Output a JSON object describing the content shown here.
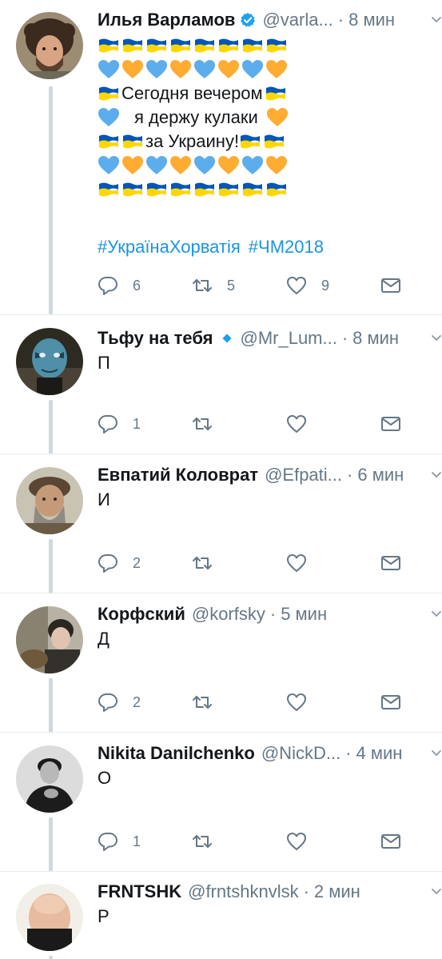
{
  "tweets": [
    {
      "name": "Илья Варламов",
      "verified": true,
      "handle": "@varla...",
      "separator": "·",
      "time": "8 мин",
      "text_lines": [
        "Сегодня вечером",
        "я держу кулаки",
        "за Украину!"
      ],
      "hashtags": [
        "#УкраїнаХорватія",
        "#ЧМ2018"
      ],
      "reply_count": "6",
      "retweet_count": "5",
      "like_count": "9"
    },
    {
      "name": "Тьфу на тебя",
      "handle": "@Mr_Lum...",
      "separator": "·",
      "time": "8 мин",
      "text": "П",
      "reply_count": "1",
      "retweet_count": "",
      "like_count": ""
    },
    {
      "name": "Евпатий Коловрат",
      "handle": "@Efpati...",
      "separator": "·",
      "time": "6 мин",
      "text": "И",
      "reply_count": "2",
      "retweet_count": "",
      "like_count": ""
    },
    {
      "name": "Корфский",
      "handle": "@korfsky",
      "separator": "·",
      "time": "5 мин",
      "text": "Д",
      "reply_count": "2",
      "retweet_count": "",
      "like_count": ""
    },
    {
      "name": "Nikita Danilchenko",
      "handle": "@NickD...",
      "separator": "·",
      "time": "4 мин",
      "text": "О",
      "reply_count": "1",
      "retweet_count": "",
      "like_count": ""
    },
    {
      "name": "FRNTSHK",
      "handle": "@frntshknvlsk",
      "separator": "·",
      "time": "2 мин",
      "text": "Р"
    }
  ],
  "colors": {
    "name": "#14171a",
    "muted": "#657786",
    "link": "#1b95e0",
    "verified": "#1da1f2",
    "thread_line": "#cfd9de",
    "flag_blue": "#0057b7",
    "flag_yellow": "#ffd700",
    "heart_blue": "#5dadec",
    "heart_yellow": "#ffac33"
  },
  "icons": {
    "reply": "reply-icon",
    "retweet": "retweet-icon",
    "like": "heart-icon",
    "dm": "envelope-icon",
    "caret": "chevron-down-icon",
    "verified": "verified-badge-icon",
    "ukraine_flag": "ukraine-flag-emoji",
    "blue_heart": "blue-heart-emoji",
    "yellow_heart": "yellow-heart-emoji"
  }
}
